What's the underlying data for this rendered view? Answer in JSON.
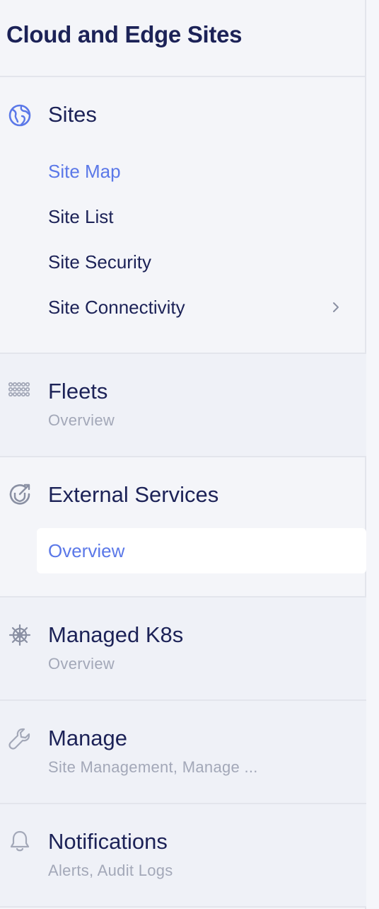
{
  "header": {
    "title": "Cloud and Edge Sites"
  },
  "sections": {
    "sites": {
      "title": "Sites",
      "icon": "globe-icon",
      "items": [
        {
          "label": "Site Map"
        },
        {
          "label": "Site List"
        },
        {
          "label": "Site Security"
        },
        {
          "label": "Site Connectivity"
        }
      ]
    },
    "fleets": {
      "title": "Fleets",
      "subtitle": "Overview",
      "icon": "fleet-icon"
    },
    "external_services": {
      "title": "External Services",
      "icon": "shield-arrow-icon",
      "items": [
        {
          "label": "Overview"
        }
      ]
    },
    "managed_k8s": {
      "title": "Managed K8s",
      "subtitle": "Overview",
      "icon": "helm-wheel-icon"
    },
    "manage": {
      "title": "Manage",
      "subtitle": "Site Management, Manage ...",
      "icon": "wrench-icon"
    },
    "notifications": {
      "title": "Notifications",
      "subtitle": "Alerts, Audit Logs",
      "icon": "bell-icon"
    }
  },
  "colors": {
    "accent": "#5b78e8",
    "text": "#1c2257",
    "muted": "#a3a8b8",
    "divider": "#e3e5ec"
  }
}
